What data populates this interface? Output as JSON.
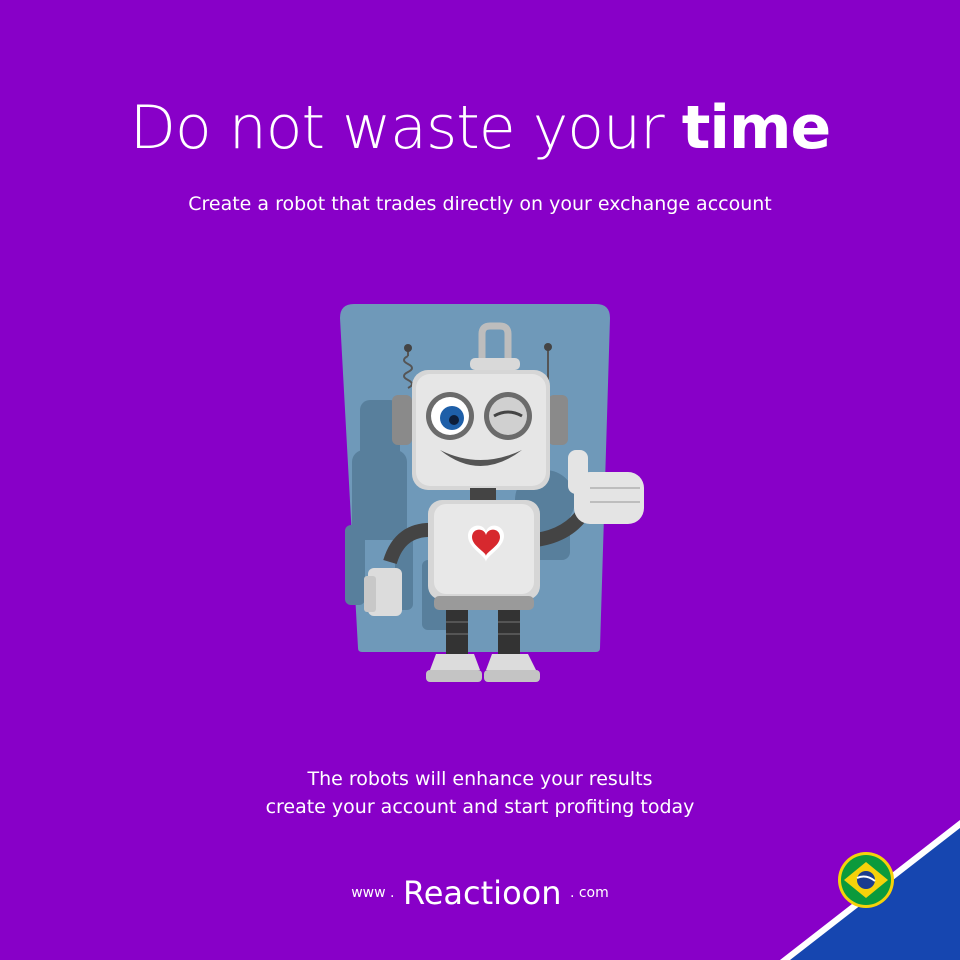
{
  "headline": {
    "light": "Do not waste your",
    "bold": "time"
  },
  "subtitle": "Create a robot that trades directly on your exchange account",
  "body": {
    "line1": "The robots will enhance your results",
    "line2": "create your account and start profiting today"
  },
  "brand": {
    "prefix": "www .",
    "name": "Reactioon",
    "suffix": ". com"
  },
  "flag_badge": {
    "icon": "brazil-flag-icon"
  },
  "colors": {
    "background": "#8800c8",
    "card": "#6f99b9",
    "corner_blue": "#1646b0",
    "text": "#ffffff"
  }
}
